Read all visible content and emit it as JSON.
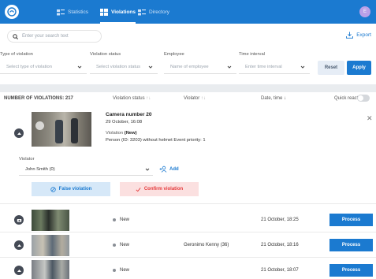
{
  "topbar": {
    "nav": [
      {
        "label": "Statistics",
        "icon": "statistics-icon"
      },
      {
        "label": "Violations",
        "icon": "violations-icon"
      },
      {
        "label": "Directory",
        "icon": "directory-icon"
      }
    ],
    "avatar_initial": "E",
    "accent": "#1b7ad0"
  },
  "search": {
    "placeholder": "Enter your search text"
  },
  "export": {
    "label": "Export"
  },
  "filters": [
    {
      "label": "Type of violation",
      "placeholder": "Select type of violation"
    },
    {
      "label": "Violation status",
      "placeholder": "Select violation status"
    },
    {
      "label": "Employee",
      "placeholder": "Name of employee"
    },
    {
      "label": "Time interval",
      "placeholder": "Enter time interval"
    }
  ],
  "buttons": {
    "reset": "Reset",
    "apply": "Apply"
  },
  "table": {
    "count_label": "NUMBER OF VIOLATIONS: 217",
    "col_status": "Violation status",
    "col_violator": "Violator",
    "col_date": "Date, time",
    "col_quick": "Quick react",
    "sort_updown": "↑↓",
    "sort_down": "↓"
  },
  "expanded": {
    "camera": "Camera number 20",
    "date": "29 October, 16:08",
    "status_prefix": "Violation",
    "status": "(New)",
    "description": "Person (ID: 3203) without helmet Event priority: 1",
    "violator_label": "Violator",
    "violator_value": "John Smith (0)",
    "add_label": "Add",
    "false_label": "False violation",
    "confirm_label": "Confirm violation"
  },
  "rows": [
    {
      "status": "New",
      "violator": "",
      "date": "21 October, 18:25",
      "action": "Process"
    },
    {
      "status": "New",
      "violator": "Geronimo Kenny (36)",
      "date": "21 October, 18:16",
      "action": "Process"
    },
    {
      "status": "New",
      "violator": "",
      "date": "21 October, 18:07",
      "action": "Process"
    }
  ]
}
